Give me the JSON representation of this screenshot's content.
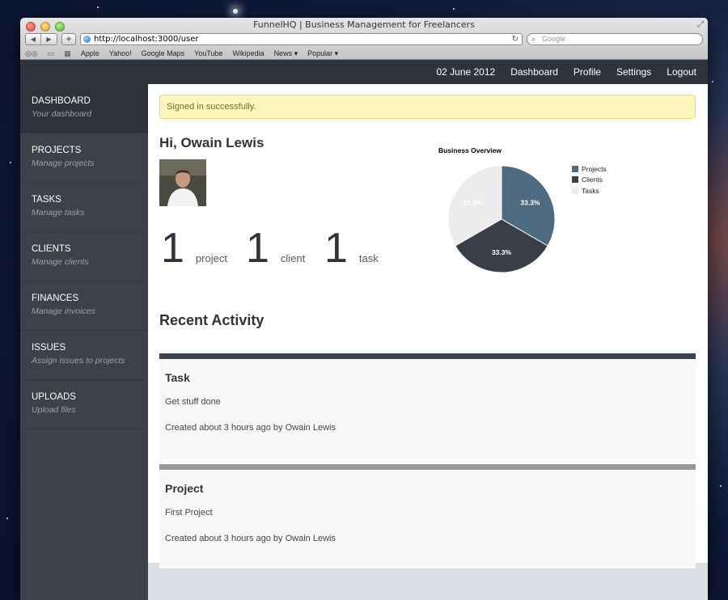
{
  "browser": {
    "window_title": "FunnelHQ | Business Management for Freelancers",
    "url": "http://localhost:3000/user",
    "search_placeholder": "Google",
    "bookmarks": [
      "Apple",
      "Yahoo!",
      "Google Maps",
      "YouTube",
      "Wikipedia",
      "News ▾",
      "Popular ▾"
    ]
  },
  "topnav": {
    "date": "02 June 2012",
    "links": [
      "Dashboard",
      "Profile",
      "Settings",
      "Logout"
    ]
  },
  "sidebar": {
    "items": [
      {
        "label": "DASHBOARD",
        "sub": "Your dashboard",
        "active": true
      },
      {
        "label": "PROJECTS",
        "sub": "Manage projects"
      },
      {
        "label": "TASKS",
        "sub": "Manage tasks"
      },
      {
        "label": "CLIENTS",
        "sub": "Manage clients"
      },
      {
        "label": "FINANCES",
        "sub": "Manage invoices"
      },
      {
        "label": "ISSUES",
        "sub": "Assign issues to projects"
      },
      {
        "label": "UPLOADS",
        "sub": "Upload files"
      }
    ]
  },
  "main": {
    "flash": "Signed in successfully.",
    "greeting": "Hi, Owain Lewis",
    "stats": [
      {
        "value": "1",
        "label": "project"
      },
      {
        "value": "1",
        "label": "client"
      },
      {
        "value": "1",
        "label": "task"
      }
    ],
    "activity_title": "Recent Activity",
    "activities": [
      {
        "type": "Task",
        "body": "Get stuff done",
        "meta": "Created about 3 hours ago by Owain Lewis",
        "bar_color": "#3d434e"
      },
      {
        "type": "Project",
        "body": "First Project",
        "meta": "Created about 3 hours ago by Owain Lewis",
        "bar_color": "#999999"
      }
    ]
  },
  "chart_data": {
    "type": "pie",
    "title": "Business Overview",
    "categories": [
      "Projects",
      "Clients",
      "Tasks"
    ],
    "values": [
      33.3,
      33.3,
      33.3
    ],
    "labels": [
      "33.3%",
      "33.3%",
      "33.3%"
    ],
    "colors": [
      "#4d6a80",
      "#3a3e48",
      "#ececec"
    ],
    "legend": "right"
  },
  "colors": {
    "nav_bg": "#2e333c",
    "sidebar_bg": "#3c414a",
    "flash_bg": "#fcf6bd"
  }
}
